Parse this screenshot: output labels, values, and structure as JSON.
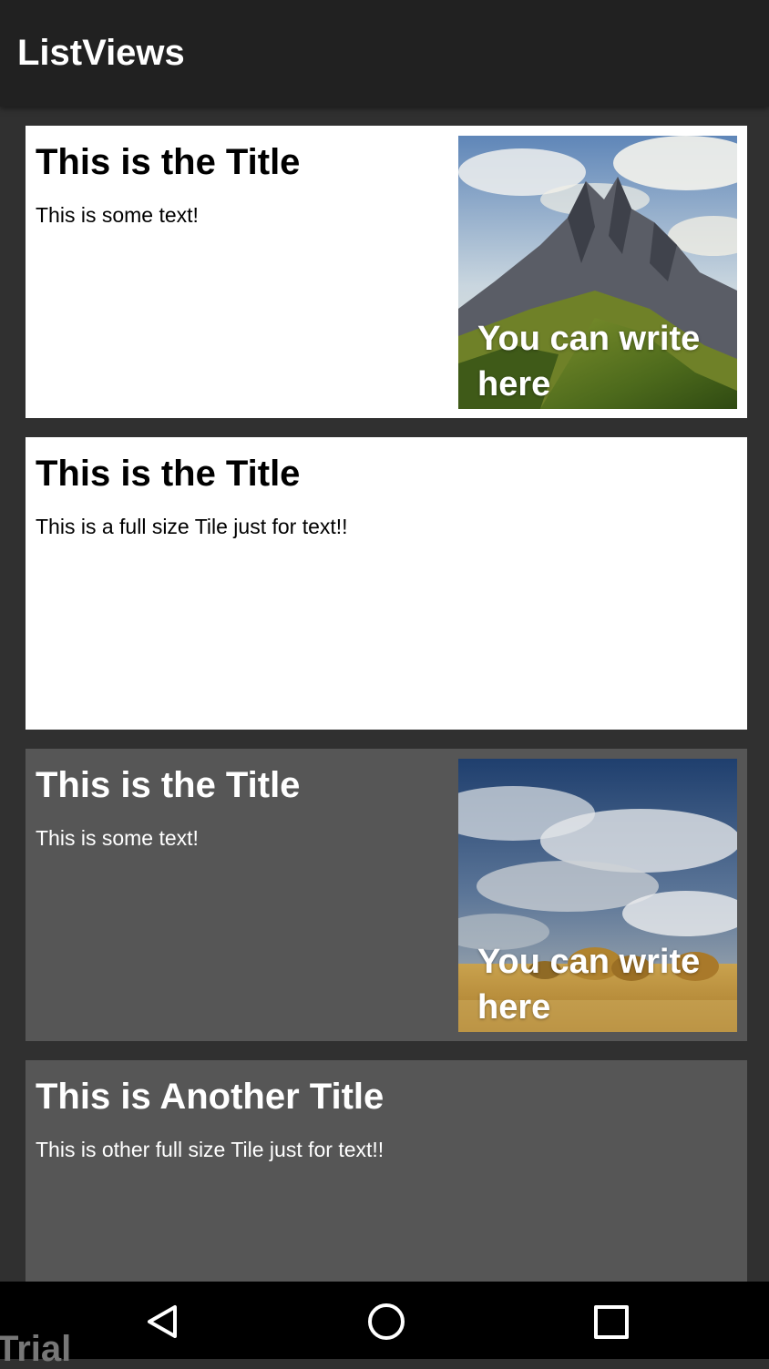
{
  "app_bar": {
    "title": "ListViews"
  },
  "tiles": [
    {
      "title": "This is the Title",
      "text": "This is some text!",
      "theme": "light",
      "image": "mountain-landscape-image",
      "image_caption": "You can write here"
    },
    {
      "title": "This is the Title",
      "text": "This is a full size Tile just for text!!",
      "theme": "light"
    },
    {
      "title": "This is the Title",
      "text": "This is some text!",
      "theme": "dark",
      "image": "cloudy-field-image",
      "image_caption": "You can write here"
    },
    {
      "title": "This is Another Title",
      "text": "This is other full size Tile just for text!!",
      "theme": "dark"
    }
  ],
  "nav_bar": {
    "watermark": "Trial",
    "icons": [
      "back-icon",
      "home-icon",
      "recents-icon"
    ]
  },
  "colors": {
    "app_bar": "#212121",
    "background": "#303030",
    "light_tile": "#ffffff",
    "dark_tile": "#565656",
    "nav_bar": "#000000"
  }
}
